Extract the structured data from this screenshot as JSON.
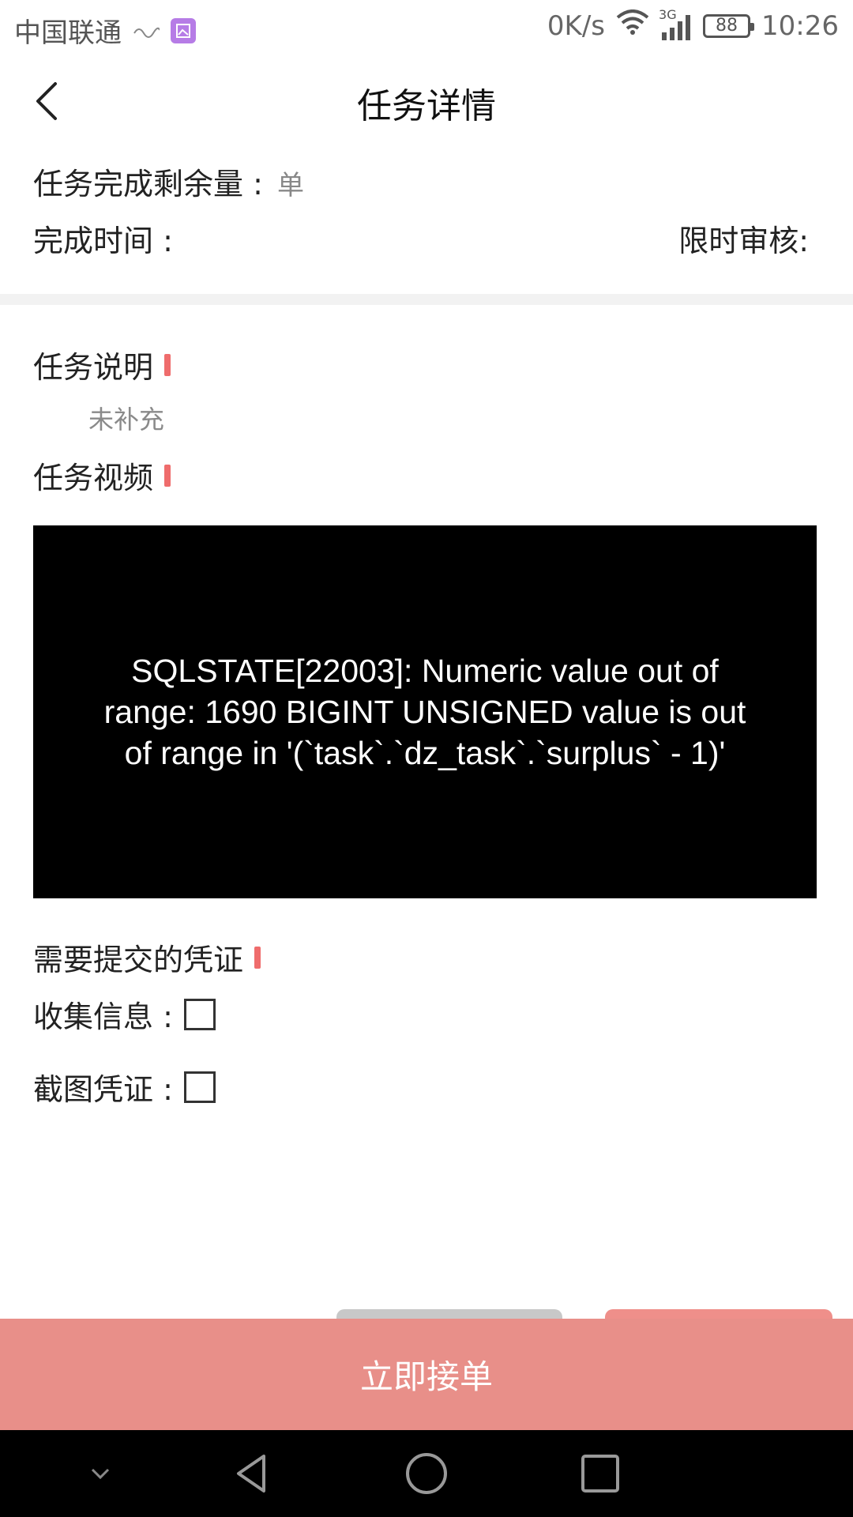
{
  "status_bar": {
    "carrier": "中国联通",
    "network_speed": "0K/s",
    "network_type": "3G",
    "battery": "88",
    "time": "10:26"
  },
  "header": {
    "title": "任务详情",
    "back_icon": "chevron-left-icon"
  },
  "info": {
    "remaining_label": "任务完成剩余量 :",
    "remaining_unit": "单",
    "time_label": "完成时间 :",
    "audit_label": "限时审核:"
  },
  "sections": {
    "description_title": "任务说明",
    "description_text": "未补充",
    "video_title": "任务视频",
    "video_error": "SQLSTATE[22003]: Numeric value out of range: 1690 BIGINT UNSIGNED value is out of range in '(`task`.`dz_task`.`surplus` - 1)'",
    "proof_title": "需要提交的凭证",
    "proof_items": [
      {
        "label": "收集信息 :"
      },
      {
        "label": "截图凭证 :"
      }
    ]
  },
  "actions": {
    "accept_label": "立即接单"
  },
  "colors": {
    "accent": "#ef6c6c",
    "button_bg": "#e88f89"
  },
  "nav_bar": {
    "icons": [
      "chevron-down-icon",
      "back-triangle-icon",
      "home-circle-icon",
      "recents-square-icon"
    ]
  }
}
